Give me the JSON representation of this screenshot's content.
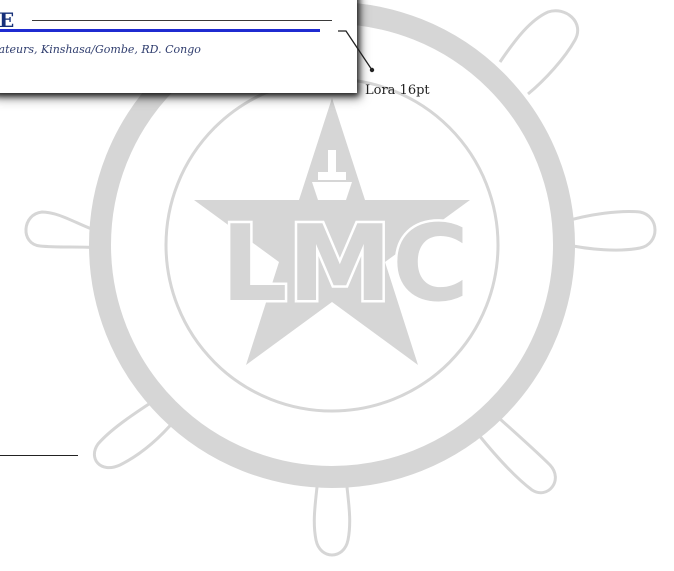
{
  "header": {
    "title_fragment": "E",
    "address": "iateurs, Kinshasa/Gombe, RD. Congo"
  },
  "annotation": {
    "font_label": "Lora 16pt"
  },
  "watermark": {
    "logo_text": "LMC",
    "color": "#d6d6d6"
  },
  "colors": {
    "heading": "#16307a",
    "rule": "#1f2bd1"
  }
}
